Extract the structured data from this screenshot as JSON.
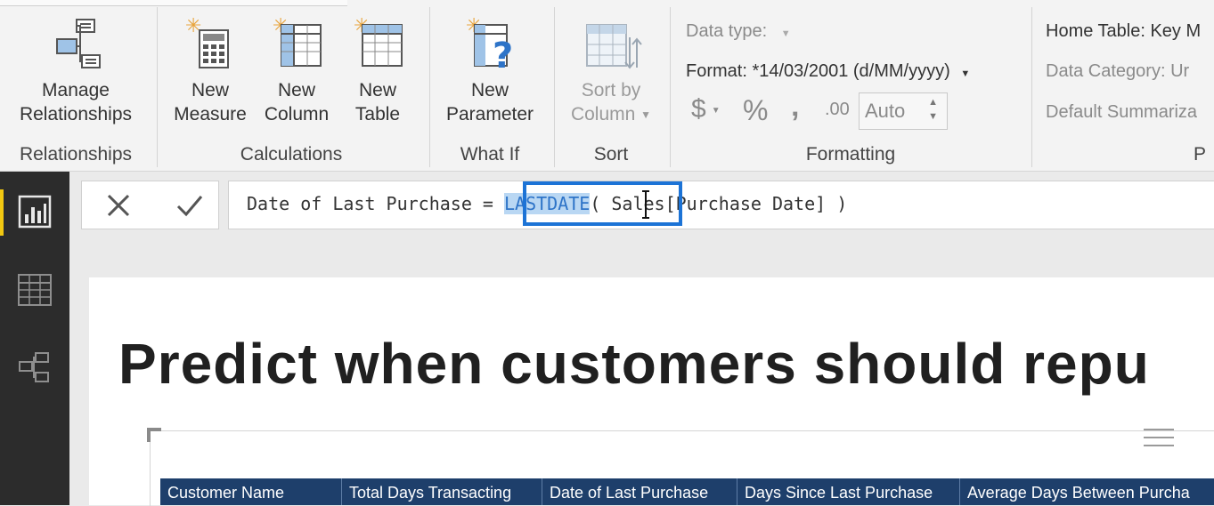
{
  "ribbon": {
    "relationships": {
      "manage_line1": "Manage",
      "manage_line2": "Relationships",
      "group_label": "Relationships"
    },
    "calculations": {
      "new_measure_line1": "New",
      "new_measure_line2": "Measure",
      "new_column_line1": "New",
      "new_column_line2": "Column",
      "new_table_line1": "New",
      "new_table_line2": "Table",
      "group_label": "Calculations"
    },
    "whatif": {
      "new_parameter_line1": "New",
      "new_parameter_line2": "Parameter",
      "group_label": "What If"
    },
    "sort": {
      "sort_line1": "Sort by",
      "sort_line2": "Column",
      "group_label": "Sort"
    },
    "formatting": {
      "data_type_label": "Data type:",
      "format_label": "Format: *14/03/2001 (d/MM/yyyy)",
      "currency_symbol": "$",
      "percent_symbol": "%",
      "comma_symbol": "‚",
      "decimal_symbol": ".00",
      "auto_value": "Auto",
      "group_label": "Formatting"
    },
    "properties": {
      "home_table": "Home Table: Key M",
      "data_category": "Data Category: Ur",
      "default_summarization": "Default Summariza",
      "group_label": "P"
    }
  },
  "formula_bar": {
    "before": "Date of Last Purchase = ",
    "selected": "LASTDATE",
    "after": "( Sales[Purchase Date] )"
  },
  "report": {
    "title": "Predict when customers should repu",
    "table_columns": [
      "Customer Name",
      "Total Days Transacting",
      "Date of Last Purchase",
      "Days Since Last Purchase",
      "Average Days Between Purcha"
    ]
  },
  "colors": {
    "accent_blue": "#1c73d6",
    "header_navy": "#1e3f6b",
    "nav_dark": "#2c2c2c",
    "active_yellow": "#f2c811"
  },
  "icons": [
    "manage-relationships-icon",
    "new-measure-icon",
    "new-column-icon",
    "new-table-icon",
    "new-parameter-icon",
    "sort-by-column-icon",
    "report-view-icon",
    "data-view-icon",
    "relationships-view-icon",
    "cancel-icon",
    "commit-icon"
  ]
}
